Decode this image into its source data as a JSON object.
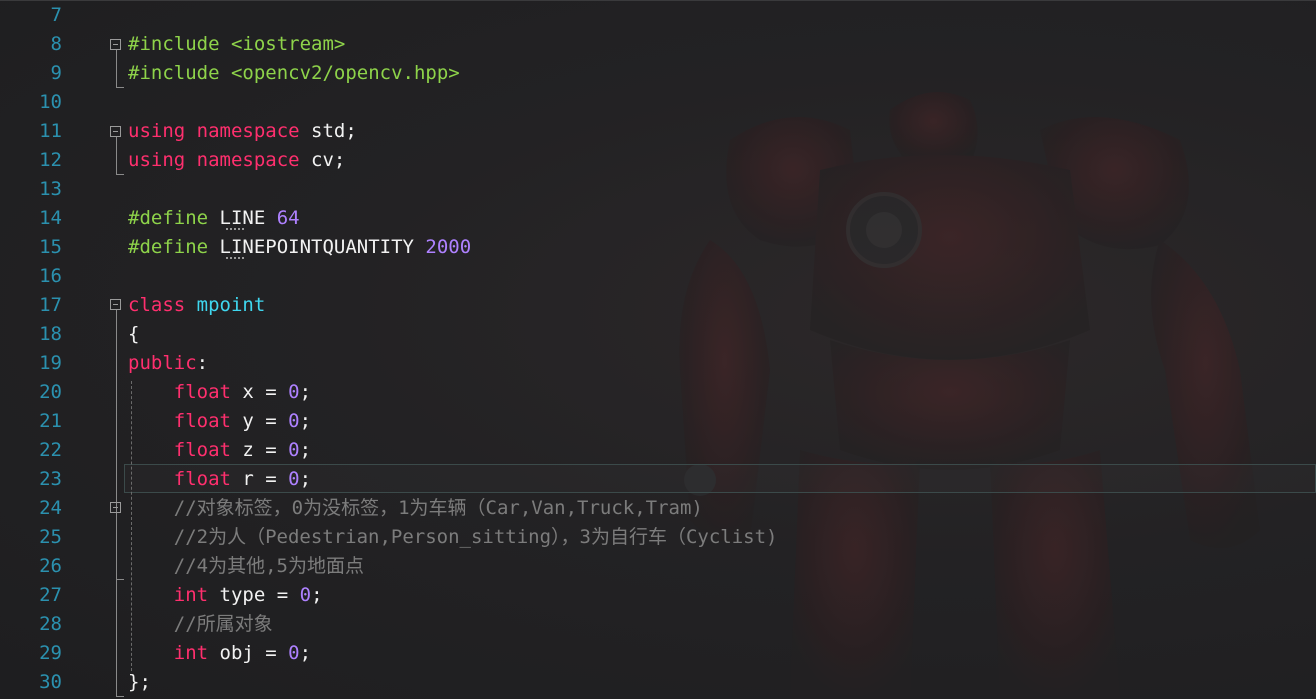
{
  "editor": {
    "lines": [
      {
        "number": "7",
        "tokens": []
      },
      {
        "number": "8",
        "tokens": [
          {
            "t": "#include ",
            "c": "pp"
          },
          {
            "t": "<iostream>",
            "c": "pp"
          }
        ]
      },
      {
        "number": "9",
        "tokens": [
          {
            "t": "#include ",
            "c": "pp"
          },
          {
            "t": "<opencv2/opencv.hpp>",
            "c": "pp"
          }
        ]
      },
      {
        "number": "10",
        "tokens": []
      },
      {
        "number": "11",
        "tokens": [
          {
            "t": "using",
            "c": "kw"
          },
          {
            "t": " ",
            "c": "tx"
          },
          {
            "t": "namespace",
            "c": "kw"
          },
          {
            "t": " std;",
            "c": "tx"
          }
        ]
      },
      {
        "number": "12",
        "tokens": [
          {
            "t": "using",
            "c": "kw"
          },
          {
            "t": " ",
            "c": "tx"
          },
          {
            "t": "namespace",
            "c": "kw"
          },
          {
            "t": " cv;",
            "c": "tx"
          }
        ]
      },
      {
        "number": "13",
        "tokens": []
      },
      {
        "number": "14",
        "tokens": [
          {
            "t": "#define",
            "c": "pp"
          },
          {
            "t": " LINE ",
            "c": "tx"
          },
          {
            "t": "64",
            "c": "num"
          }
        ]
      },
      {
        "number": "15",
        "tokens": [
          {
            "t": "#define",
            "c": "pp"
          },
          {
            "t": " LINEPOINTQUANTITY ",
            "c": "tx"
          },
          {
            "t": "2000",
            "c": "num"
          }
        ]
      },
      {
        "number": "16",
        "tokens": []
      },
      {
        "number": "17",
        "tokens": [
          {
            "t": "class",
            "c": "kw"
          },
          {
            "t": " ",
            "c": "tx"
          },
          {
            "t": "mpoint",
            "c": "cls"
          }
        ]
      },
      {
        "number": "18",
        "tokens": [
          {
            "t": "{",
            "c": "tx"
          }
        ]
      },
      {
        "number": "19",
        "tokens": [
          {
            "t": "public",
            "c": "kw"
          },
          {
            "t": ":",
            "c": "tx"
          }
        ]
      },
      {
        "number": "20",
        "tokens": [
          {
            "t": "    ",
            "c": "tx"
          },
          {
            "t": "float",
            "c": "kw"
          },
          {
            "t": " x = ",
            "c": "tx"
          },
          {
            "t": "0",
            "c": "num"
          },
          {
            "t": ";",
            "c": "tx"
          }
        ]
      },
      {
        "number": "21",
        "tokens": [
          {
            "t": "    ",
            "c": "tx"
          },
          {
            "t": "float",
            "c": "kw"
          },
          {
            "t": " y = ",
            "c": "tx"
          },
          {
            "t": "0",
            "c": "num"
          },
          {
            "t": ";",
            "c": "tx"
          }
        ]
      },
      {
        "number": "22",
        "tokens": [
          {
            "t": "    ",
            "c": "tx"
          },
          {
            "t": "float",
            "c": "kw"
          },
          {
            "t": " z = ",
            "c": "tx"
          },
          {
            "t": "0",
            "c": "num"
          },
          {
            "t": ";",
            "c": "tx"
          }
        ]
      },
      {
        "number": "23",
        "tokens": [
          {
            "t": "    ",
            "c": "tx"
          },
          {
            "t": "float",
            "c": "kw"
          },
          {
            "t": " r = ",
            "c": "tx"
          },
          {
            "t": "0",
            "c": "num"
          },
          {
            "t": ";",
            "c": "tx"
          }
        ]
      },
      {
        "number": "24",
        "tokens": [
          {
            "t": "    //对象标签，0为没标签，1为车辆（Car,Van,Truck,Tram)",
            "c": "cm"
          }
        ]
      },
      {
        "number": "25",
        "tokens": [
          {
            "t": "    //2为人（Pedestrian,Person_sitting），3为自行车（Cyclist)",
            "c": "cm"
          }
        ]
      },
      {
        "number": "26",
        "tokens": [
          {
            "t": "    //4为其他,5为地面点",
            "c": "cm"
          }
        ]
      },
      {
        "number": "27",
        "tokens": [
          {
            "t": "    ",
            "c": "tx"
          },
          {
            "t": "int",
            "c": "kw"
          },
          {
            "t": " type = ",
            "c": "tx"
          },
          {
            "t": "0",
            "c": "num"
          },
          {
            "t": ";",
            "c": "tx"
          }
        ]
      },
      {
        "number": "28",
        "tokens": [
          {
            "t": "    //所属对象",
            "c": "cm"
          }
        ]
      },
      {
        "number": "29",
        "tokens": [
          {
            "t": "    ",
            "c": "tx"
          },
          {
            "t": "int",
            "c": "kw"
          },
          {
            "t": " obj = ",
            "c": "tx"
          },
          {
            "t": "0",
            "c": "num"
          },
          {
            "t": ";",
            "c": "tx"
          }
        ]
      },
      {
        "number": "30",
        "tokens": [
          {
            "t": "};",
            "c": "tx"
          }
        ]
      }
    ],
    "current_line": "23",
    "colors": {
      "background": "#1f1f21",
      "line_number": "#2b91af",
      "keyword": "#ff2f6e",
      "preprocessor": "#8ed34a",
      "number": "#ae81ff",
      "class_name": "#3fd7ef",
      "comment": "#7c7c7c",
      "text": "#f2f2f2"
    }
  }
}
